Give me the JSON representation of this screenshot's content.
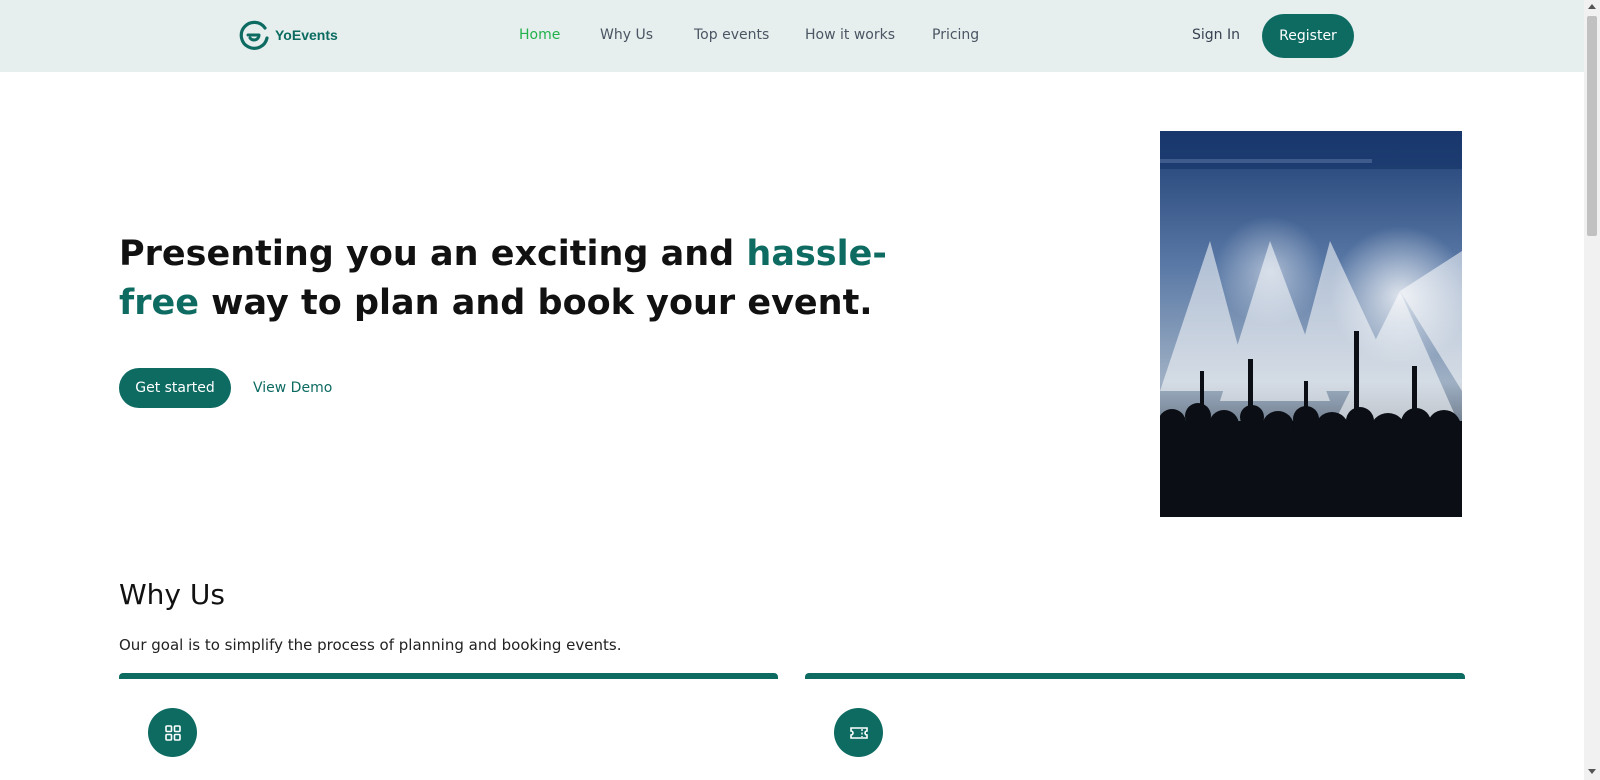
{
  "brand": {
    "name": "YoEvents",
    "accent_color": "#0d6b62",
    "active_nav_color": "#22b14c"
  },
  "nav": {
    "items": [
      {
        "label": "Home",
        "active": true
      },
      {
        "label": "Why Us",
        "active": false
      },
      {
        "label": "Top events",
        "active": false
      },
      {
        "label": "How it works",
        "active": false
      },
      {
        "label": "Pricing",
        "active": false
      }
    ],
    "sign_in": "Sign In",
    "register": "Register"
  },
  "hero": {
    "title_prefix": "Presenting you an exciting and ",
    "title_accent": "hassle-free",
    "title_suffix": " way to plan and book your event.",
    "primary_cta": "Get started",
    "secondary_cta": "View Demo",
    "image_icon": "concert-crowd-photo"
  },
  "why_us": {
    "title": "Why Us",
    "subtitle": "Our goal is to simplify the process of planning and booking events.",
    "cards": [
      {
        "icon": "grid-icon"
      },
      {
        "icon": "ticket-icon"
      }
    ]
  }
}
